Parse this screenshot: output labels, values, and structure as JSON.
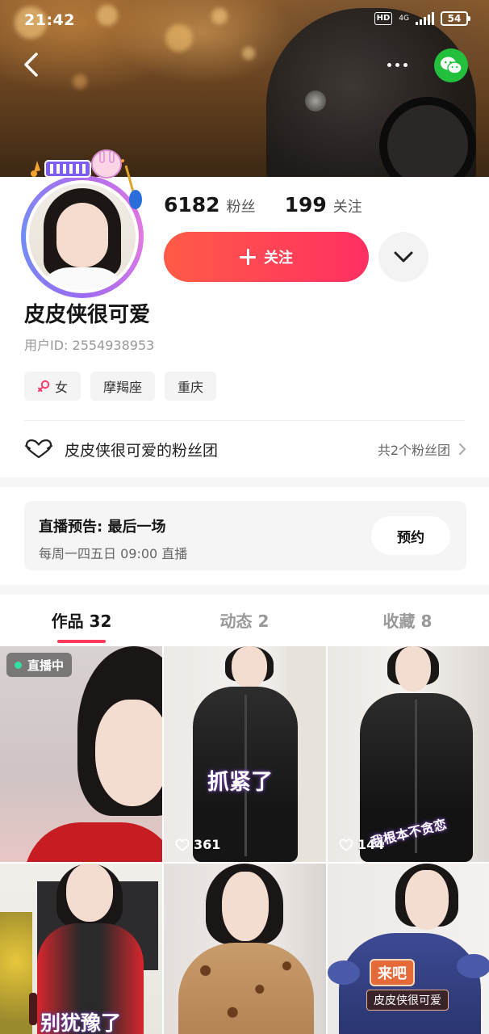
{
  "status_bar": {
    "time": "21:42",
    "hd": "HD",
    "network": "4G",
    "battery": "54"
  },
  "header": {
    "back_icon": "chevron-left-icon",
    "more_icon": "more-dots-icon",
    "share_icon": "wechat-icon"
  },
  "profile": {
    "followers_count": "6182",
    "followers_label": "粉丝",
    "following_count": "199",
    "following_label": "关注",
    "follow_button": "关注",
    "nickname": "皮皮侠很可爱",
    "user_id": "用户ID: 2554938953",
    "tags": [
      "女",
      "摩羯座",
      "重庆"
    ],
    "fanclub_name": "皮皮侠很可爱的粉丝团",
    "fanclub_count": "共2个粉丝团"
  },
  "live_preview": {
    "title": "直播预告: 最后一场",
    "schedule": "每周一四五日 09:00 直播",
    "reserve_button": "预约"
  },
  "tabs": [
    {
      "label": "作品 32",
      "active": true
    },
    {
      "label": "动态 2",
      "active": false
    },
    {
      "label": "收藏 8",
      "active": false
    }
  ],
  "grid": {
    "live_badge": "直播中",
    "tiles": [
      {
        "likes": "",
        "caption": ""
      },
      {
        "likes": "361",
        "caption": "抓紧了"
      },
      {
        "likes": "144",
        "caption": "我根本不贪恋"
      },
      {
        "likes": "",
        "caption": "别犹豫了"
      },
      {
        "likes": "",
        "caption": ""
      },
      {
        "likes": "",
        "caption": "来吧",
        "caption_name": "皮皮侠很可爱"
      }
    ]
  },
  "colors": {
    "accent": "#ff3c5d",
    "follow_gradient_start": "#ff5b47",
    "follow_gradient_end": "#ff2f62",
    "wechat": "#22c03c",
    "live_dot": "#33e0a2"
  }
}
